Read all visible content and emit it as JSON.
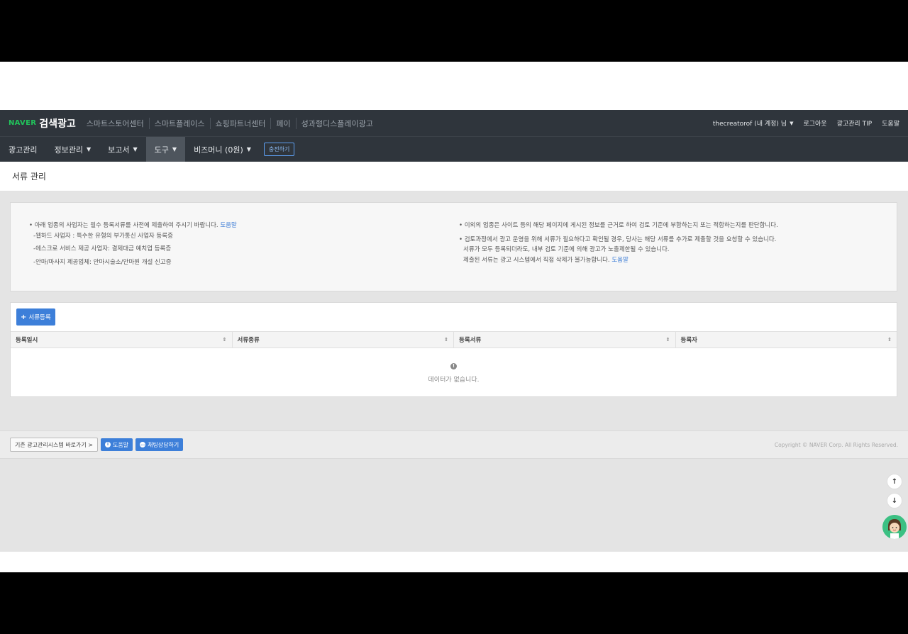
{
  "topbar": {
    "brand_naver": "NAVER",
    "brand_title": "검색광고",
    "services": [
      "스마트스토어센터",
      "스마트플레이스",
      "쇼핑파트너센터",
      "페이",
      "성과형디스플레이광고"
    ],
    "account": "thecreatorof (내 계정) 님",
    "logout": "로그아웃",
    "tip": "광고관리 TIP",
    "help": "도움말"
  },
  "nav": {
    "items": [
      {
        "label": "광고관리",
        "caret": false
      },
      {
        "label": "정보관리",
        "caret": true
      },
      {
        "label": "보고서",
        "caret": true
      },
      {
        "label": "도구",
        "caret": true,
        "active": true
      },
      {
        "label": "비즈머니 (0원)",
        "caret": true
      }
    ],
    "charge": "충전하기"
  },
  "page": {
    "title": "서류 관리"
  },
  "notice": {
    "left": {
      "line1": "• 아래 업종의 사업자는 필수 등록서류를 사전에 제출하여 주시기 바랍니다.",
      "line1_link": "도움말",
      "items": [
        "-웹하드 사업자 : 특수한 유형의 부가통신 사업자 등록증",
        "-에스크로 서비스 제공 사업자: 결제대금 예치업 등록증",
        "-안마/마사지 제공업체: 안마시술소/안마원 개설 신고증"
      ]
    },
    "right": {
      "line1": "• 이외의 업종은 사이트 등의 해당 페이지에 게시된 정보를 근거로 하여 검토 기준에 부합하는지 또는 적합하는지를 판단합니다.",
      "line2": "• 검토과정에서 광고 운영을 위해 서류가 필요하다고 확인될 경우, 당사는 해당 서류를 추가로 제출할 것을 요청할 수 있습니다.",
      "line3": "서류가 모두 등록되더라도, 내부 검토 기준에 의해 광고가 노출제한될 수 있습니다.",
      "line4": "제출된 서류는 광고 시스템에서 직접 삭제가 불가능합니다.",
      "line4_link": "도움말"
    }
  },
  "table": {
    "add_button": "서류등록",
    "columns": [
      "등록일시",
      "서류종류",
      "등록서류",
      "등록자"
    ],
    "empty_text": "데이터가 없습니다."
  },
  "footer": {
    "legacy": "기존 광고관리시스템 바로가기 >",
    "help": "도움말",
    "chat": "채팅상담하기",
    "copyright": "Copyright © NAVER Corp. All Rights Reserved."
  }
}
